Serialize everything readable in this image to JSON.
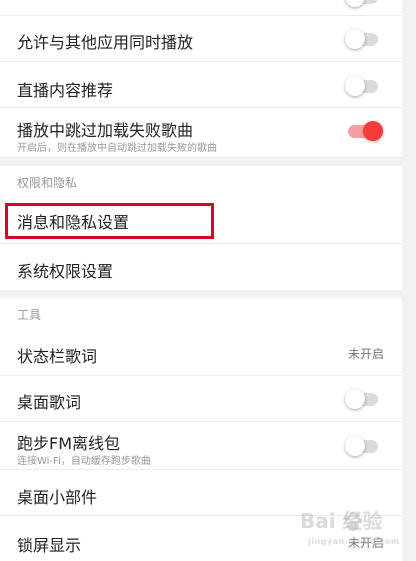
{
  "settings": {
    "concurrent_play": {
      "label": "允许与其他应用同时播放",
      "state": "off"
    },
    "live_recommend": {
      "label": "直播内容推荐",
      "state": "off"
    },
    "skip_failed": {
      "label": "播放中跳过加载失败歌曲",
      "sub": "开启后，则在播放中自动跳过加载失败的歌曲",
      "state": "on"
    }
  },
  "sections": {
    "privacy": {
      "header": "权限和隐私",
      "items": {
        "msg_privacy": "消息和隐私设置",
        "sys_perm": "系统权限设置"
      }
    },
    "tools": {
      "header": "工具",
      "items": {
        "statusbar_lyrics": {
          "label": "状态栏歌词",
          "value": "未开启"
        },
        "desktop_lyrics": {
          "label": "桌面歌词",
          "state": "off"
        },
        "run_fm": {
          "label": "跑步FM离线包",
          "sub": "连接Wi-Fi，自动缓存跑步歌曲",
          "state": "off"
        },
        "widget": {
          "label": "桌面小部件"
        },
        "lockscreen": {
          "label": "锁屏显示",
          "value": "未开启"
        }
      }
    }
  },
  "watermark": {
    "brand": "Bai 经验",
    "sub": "jingyan.baidu.com"
  },
  "colors": {
    "accent": "#f23c3c",
    "highlight": "#d10a1e",
    "section_bg": "#f2f2f2"
  }
}
